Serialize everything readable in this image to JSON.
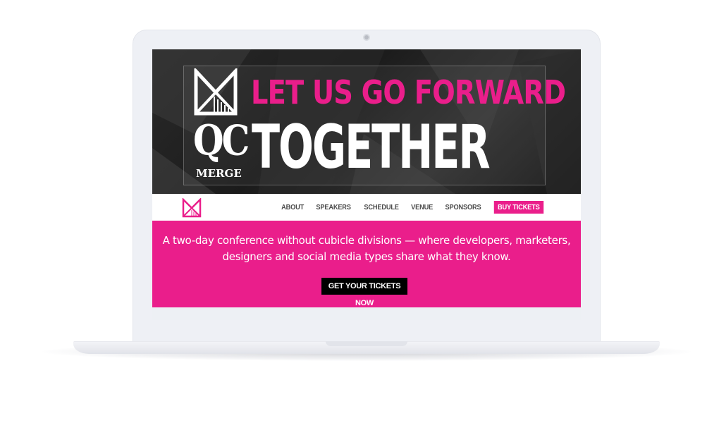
{
  "hero": {
    "logo_letters": "QC",
    "logo_word": "MERGE",
    "tagline_line1": "LET US GO FORWARD",
    "tagline_line2": "TOGETHER"
  },
  "nav": {
    "items": [
      "ABOUT",
      "SPEAKERS",
      "SCHEDULE",
      "VENUE",
      "SPONSORS"
    ],
    "buy_label": "BUY TICKETS"
  },
  "intro": {
    "text": "A two-day conference without cubicle divisions — where developers, marketers, designers and social media types share what they know.",
    "cta_label": "GET YOUR TICKETS NOW"
  },
  "colors": {
    "accent": "#ea1e8b",
    "hero_bg": "#1e1e1e",
    "cta_bg": "#000000"
  },
  "icons": [
    "qc-merge-logo-icon",
    "camera-icon"
  ]
}
